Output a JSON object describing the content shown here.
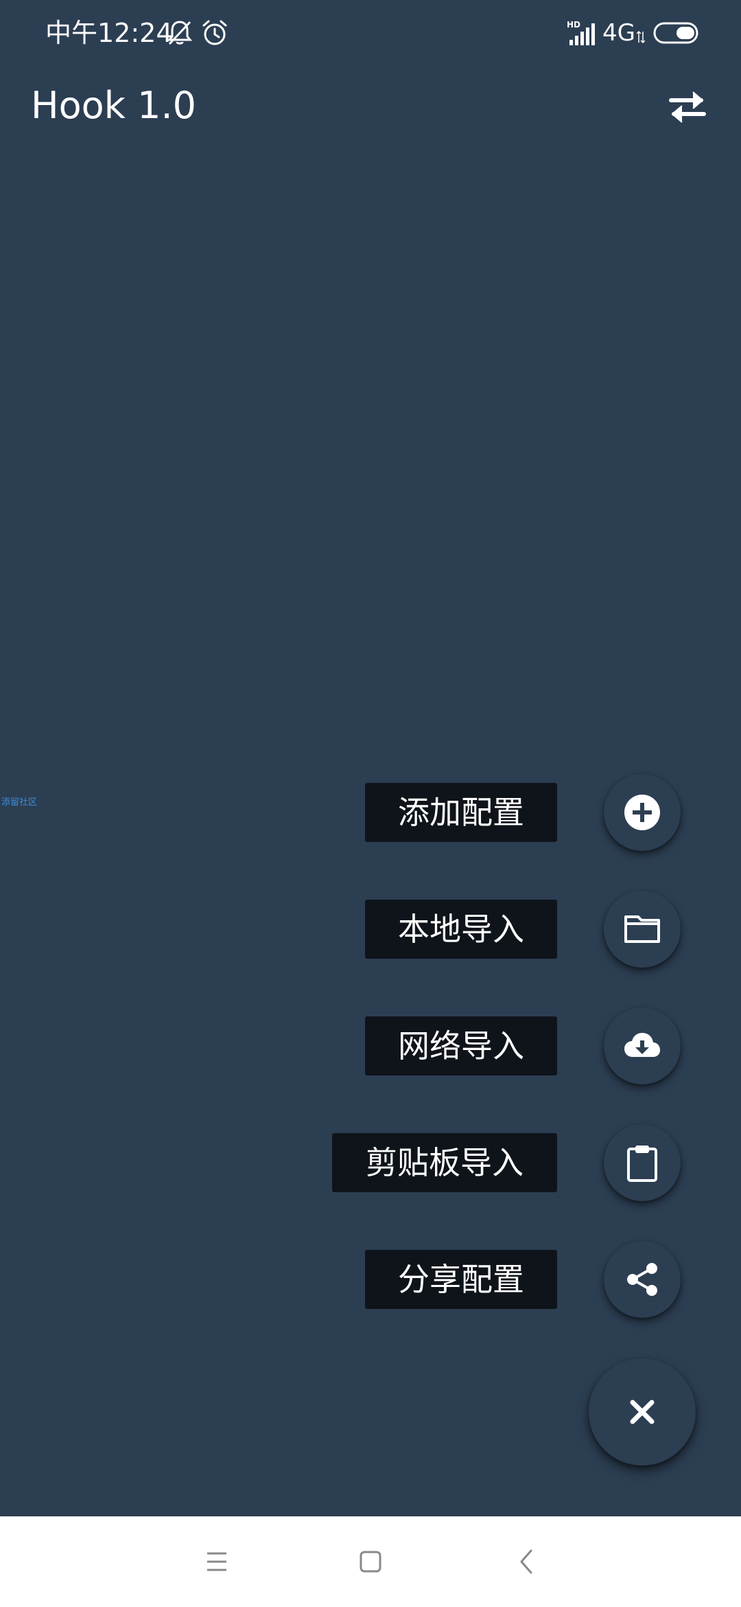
{
  "status_bar": {
    "time": "中午12:24",
    "network": "4G"
  },
  "app_bar": {
    "title": "Hook 1.0"
  },
  "watermark": "添留社区",
  "fab_menu": {
    "items": [
      {
        "label": "添加配置",
        "icon": "add-circle-icon"
      },
      {
        "label": "本地导入",
        "icon": "folder-icon"
      },
      {
        "label": "网络导入",
        "icon": "cloud-download-icon"
      },
      {
        "label": "剪贴板导入",
        "icon": "clipboard-icon"
      },
      {
        "label": "分享配置",
        "icon": "share-icon"
      }
    ],
    "close_icon": "close-icon"
  },
  "nav_bar": {
    "icons": [
      "menu-icon",
      "home-icon",
      "back-icon"
    ]
  },
  "colors": {
    "background": "#2c3e52",
    "label_background": "#0f141b",
    "nav_background": "#ffffff"
  }
}
